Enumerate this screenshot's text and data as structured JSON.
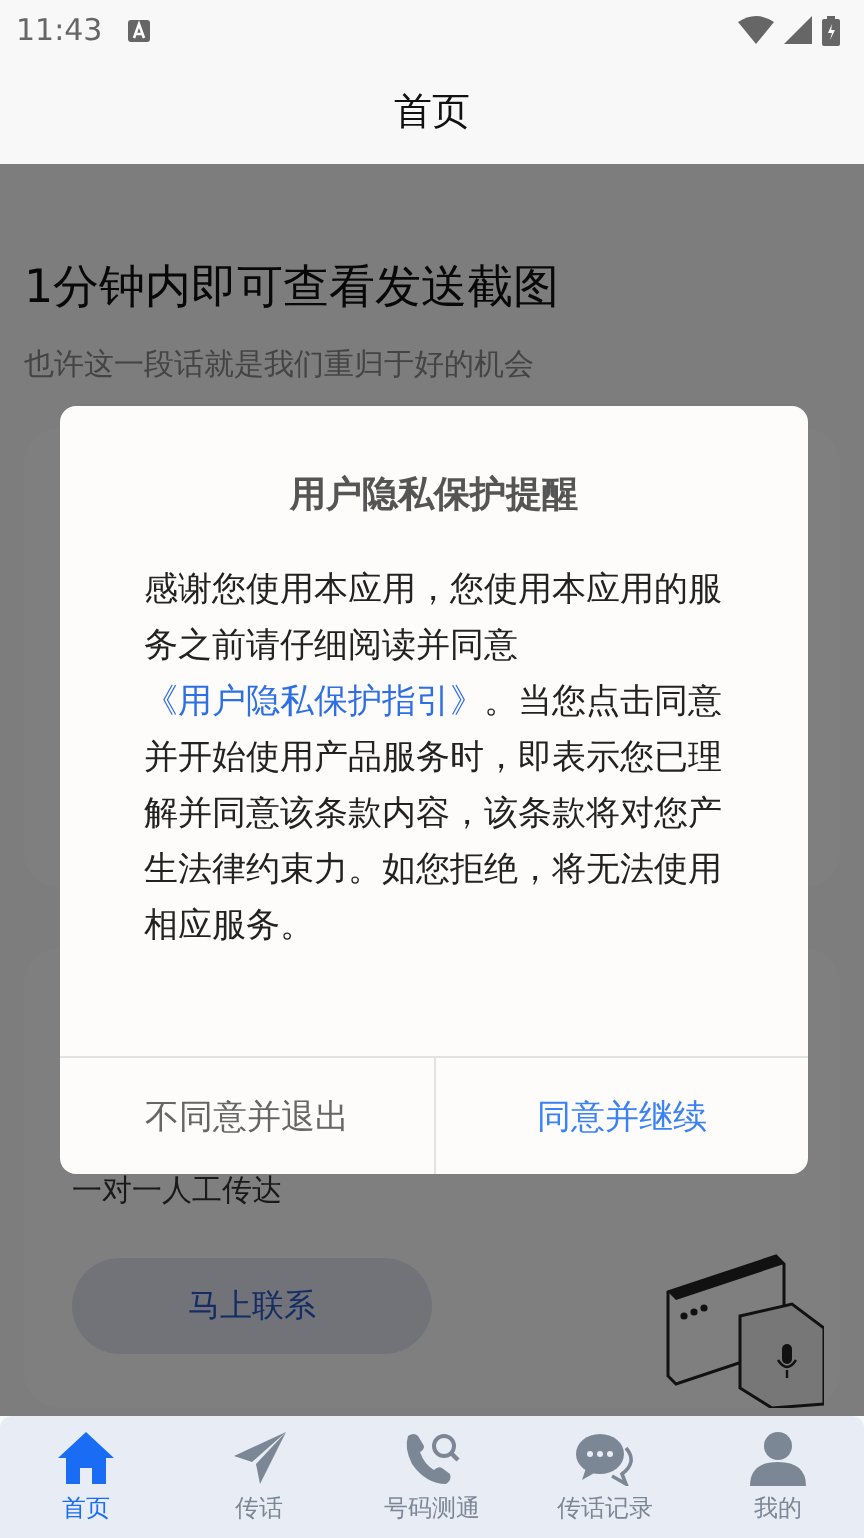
{
  "status_bar": {
    "time": "11:43"
  },
  "header": {
    "title": "首页"
  },
  "hero": {
    "title": "1分钟内即可查看发送截图",
    "subtitle": "也许这一段话就是我们重归于好的机会"
  },
  "service_card": {
    "text": "一对一人工传达",
    "button": "马上联系"
  },
  "dialog": {
    "title": "用户隐私保护提醒",
    "body_before": "感谢您使用本应用，您使用本应用的服务之前请仔细阅读并同意",
    "link": "《用户隐私保护指引》",
    "body_after": "。当您点击同意并开始使用产品服务时，即表示您已理解并同意该条款内容，该条款将对您产生法律约束力。如您拒绝，将无法使用相应服务。",
    "buttons": [
      {
        "label": "不同意并退出",
        "kind": "secondary"
      },
      {
        "label": "同意并继续",
        "kind": "primary"
      }
    ]
  },
  "tabs": [
    {
      "label": "首页",
      "kind": "home",
      "selected": true
    },
    {
      "label": "传话",
      "kind": "plane",
      "selected": false
    },
    {
      "label": "号码测通",
      "kind": "phone",
      "selected": false
    },
    {
      "label": "传话记录",
      "kind": "chat",
      "selected": false
    },
    {
      "label": "我的",
      "kind": "user",
      "selected": false
    }
  ]
}
